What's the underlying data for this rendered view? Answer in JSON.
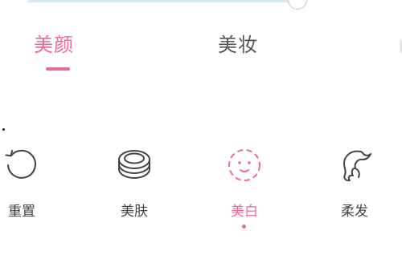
{
  "colors": {
    "accent": "#f0679a",
    "text_dark": "#555555",
    "text_muted": "#444444",
    "icon": "#444444"
  },
  "tabs": [
    {
      "label": "美颜",
      "selected": true
    },
    {
      "label": "美妆",
      "selected": false
    }
  ],
  "tools": [
    {
      "label": "重置",
      "icon": "reset-icon",
      "selected": false
    },
    {
      "label": "美肤",
      "icon": "compact-icon",
      "selected": false
    },
    {
      "label": "美白",
      "icon": "face-icon",
      "selected": true
    },
    {
      "label": "柔发",
      "icon": "hair-icon",
      "selected": false
    }
  ]
}
